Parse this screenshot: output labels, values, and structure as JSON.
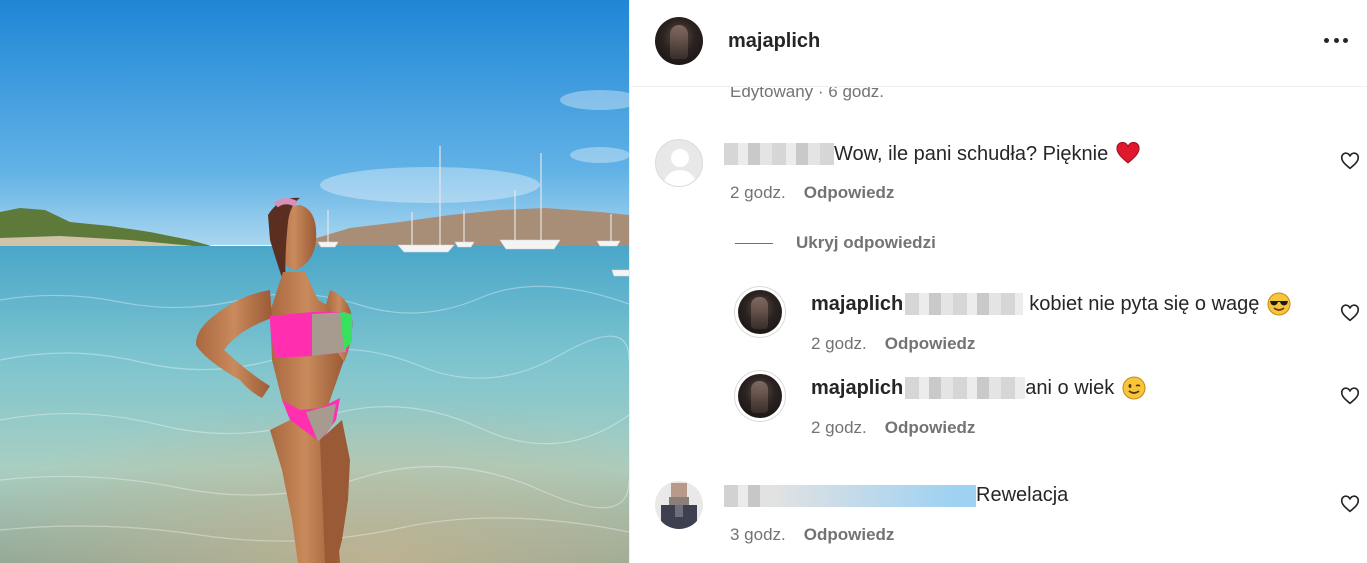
{
  "post": {
    "author": "majaplich",
    "edited_label": "Edytowany · 6 godz."
  },
  "comments": [
    {
      "text": "Wow, ile pani schudła? Pięknie",
      "time": "2 godz.",
      "reply_label": "Odpowiedz",
      "emoji": "red-heart"
    },
    {
      "author": "majaplich",
      "text": "kobiet nie pyta się o wagę",
      "time": "2 godz.",
      "reply_label": "Odpowiedz",
      "emoji": "sunglasses-face"
    },
    {
      "author": "majaplich",
      "text": "ani o wiek",
      "time": "2 godz.",
      "reply_label": "Odpowiedz",
      "emoji": "winking-face"
    },
    {
      "text": "Rewelacja",
      "time": "3 godz.",
      "reply_label": "Odpowiedz"
    }
  ],
  "hide_replies_label": "Ukryj odpowiedzi",
  "colors": {
    "text": "#262626",
    "secondary": "#737373",
    "divider": "#efefef"
  }
}
